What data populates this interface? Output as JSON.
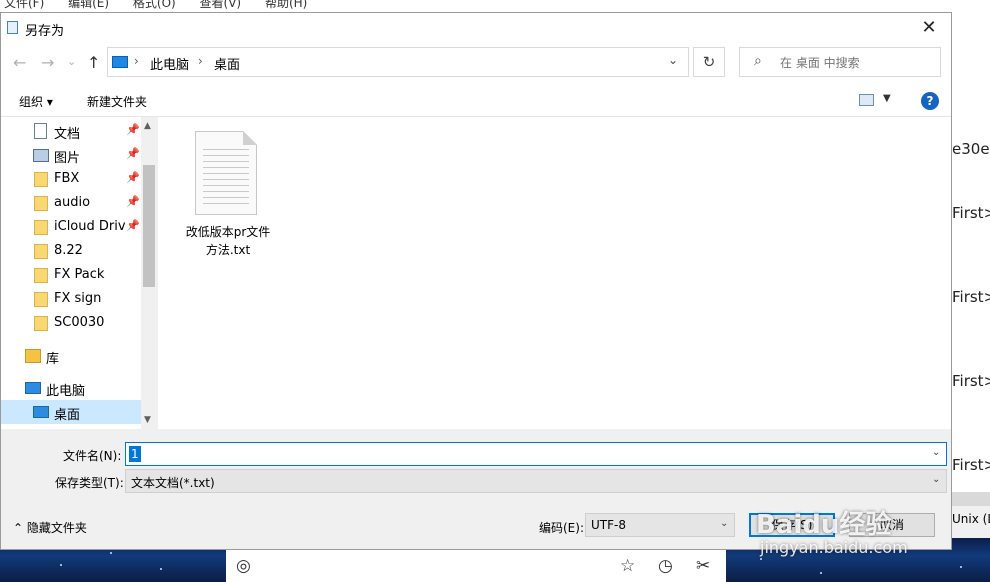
{
  "background": {
    "menu": [
      "文件(F)",
      "编辑(E)",
      "格式(O)",
      "查看(V)",
      "帮助(H)"
    ],
    "text_lines": [
      "e30e\"",
      "First>",
      "First>",
      "First>",
      "First>"
    ],
    "status_text": "Unix (L"
  },
  "dialog": {
    "title": "另存为",
    "close_glyph": "✕"
  },
  "address": {
    "back": "←",
    "forward": "→",
    "dropdown": "⌄",
    "up": "↑",
    "crumbs": [
      "此电脑",
      "桌面"
    ],
    "sep": "›",
    "refresh": "↻",
    "search_placeholder": "在 桌面 中搜索",
    "search_icon": "⌕"
  },
  "toolbar": {
    "organize": "组织 ▾",
    "new_folder": "新建文件夹",
    "view_dropdown": "▼",
    "help": "?"
  },
  "nav": {
    "items": [
      {
        "label": "文档",
        "icon": "document-icon",
        "pinned": true
      },
      {
        "label": "图片",
        "icon": "pictures-icon",
        "pinned": true
      },
      {
        "label": "FBX",
        "icon": "folder-icon",
        "pinned": true
      },
      {
        "label": "audio",
        "icon": "folder-icon",
        "pinned": true
      },
      {
        "label": "iCloud Driv",
        "icon": "folder-icon",
        "pinned": true
      },
      {
        "label": "8.22",
        "icon": "folder-icon",
        "pinned": false
      },
      {
        "label": "FX Pack",
        "icon": "folder-icon",
        "pinned": false
      },
      {
        "label": "FX sign",
        "icon": "folder-icon",
        "pinned": false
      },
      {
        "label": "SC0030",
        "icon": "folder-icon",
        "pinned": false
      }
    ],
    "library": "库",
    "this_pc": "此电脑",
    "desktop": "桌面",
    "pin_glyph": "📌",
    "scroll_up": "▲",
    "scroll_down": "▼"
  },
  "files": [
    {
      "name_line1": "改低版本pr文件",
      "name_line2": "方法.txt"
    }
  ],
  "form": {
    "filename_label": "文件名(N):",
    "filename_value": "1",
    "filetype_label": "保存类型(T):",
    "filetype_value": "文本文档(*.txt)",
    "dropdown": "⌄"
  },
  "bottom": {
    "hide_folders": "⌃ 隐藏文件夹",
    "encoding_label": "编码(E):",
    "encoding_value": "UTF-8",
    "save": "保存(S)",
    "cancel": "取消"
  },
  "taskbar": {
    "icons": [
      "search-icon",
      "star-icon",
      "history-icon",
      "tools-icon"
    ],
    "glyphs": [
      "◎",
      "☆",
      "◷",
      "✂"
    ]
  },
  "watermark": {
    "brand": "Baidu经验",
    "url": "jingyan.baidu.com"
  }
}
